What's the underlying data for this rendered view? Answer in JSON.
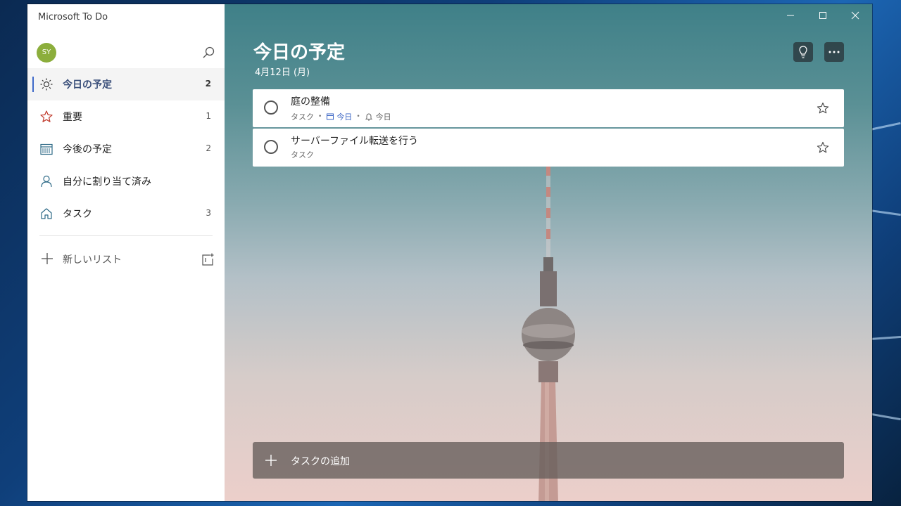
{
  "app": {
    "title": "Microsoft To Do"
  },
  "user": {
    "initials": "SY"
  },
  "sidebar": {
    "items": [
      {
        "label": "今日の予定",
        "count": "2",
        "icon": "sun-icon",
        "active": true
      },
      {
        "label": "重要",
        "count": "1",
        "icon": "star-icon"
      },
      {
        "label": "今後の予定",
        "count": "2",
        "icon": "calendar-icon"
      },
      {
        "label": "自分に割り当て済み",
        "count": "",
        "icon": "person-icon"
      },
      {
        "label": "タスク",
        "count": "3",
        "icon": "home-icon"
      }
    ],
    "new_list_label": "新しいリスト"
  },
  "main": {
    "title": "今日の予定",
    "date": "4月12日 (月)",
    "tasks": [
      {
        "title": "庭の整備",
        "list": "タスク",
        "due": "今日",
        "reminder": "今日"
      },
      {
        "title": "サーバーファイル転送を行う",
        "list": "タスク"
      }
    ],
    "add_task_label": "タスクの追加"
  },
  "colors": {
    "accent": "#3e69c9",
    "avatar": "#8cae3c",
    "important_star": "#c0392b"
  }
}
